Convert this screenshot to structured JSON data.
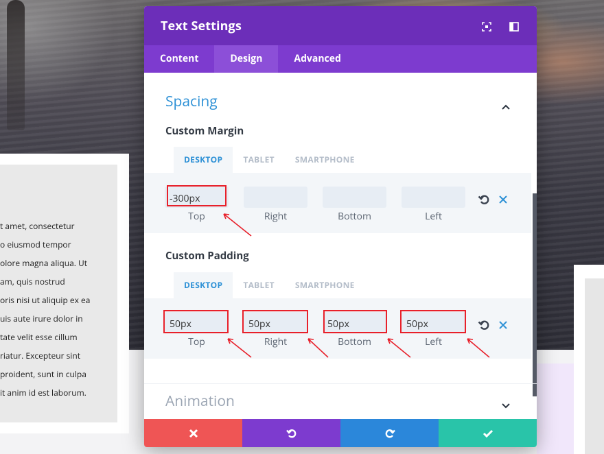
{
  "modal": {
    "title": "Text Settings",
    "tabs": [
      "Content",
      "Design",
      "Advanced"
    ],
    "active_tab": "Design"
  },
  "spacing": {
    "title": "Spacing",
    "custom_margin": {
      "label": "Custom Margin",
      "device_tabs": [
        "DESKTOP",
        "TABLET",
        "SMARTPHONE"
      ],
      "fields": [
        {
          "label": "Top",
          "value": "-300px"
        },
        {
          "label": "Right",
          "value": ""
        },
        {
          "label": "Bottom",
          "value": ""
        },
        {
          "label": "Left",
          "value": ""
        }
      ]
    },
    "custom_padding": {
      "label": "Custom Padding",
      "device_tabs": [
        "DESKTOP",
        "TABLET",
        "SMARTPHONE"
      ],
      "fields": [
        {
          "label": "Top",
          "value": "50px"
        },
        {
          "label": "Right",
          "value": "50px"
        },
        {
          "label": "Bottom",
          "value": "50px"
        },
        {
          "label": "Left",
          "value": "50px"
        }
      ]
    }
  },
  "animation": {
    "title": "Animation"
  },
  "background_text": {
    "lines": [
      "t amet, consectetur",
      "o eiusmod tempor",
      "olore magna aliqua. Ut",
      "am, quis nostrud",
      "oris nisi ut aliquip ex ea",
      "uis aute irure dolor in",
      "tate velit esse cillum",
      "riatur. Excepteur sint",
      "proident, sunt in culpa",
      "it anim id est laborum."
    ]
  },
  "colors": {
    "header": "#6c2eb9",
    "tabs_bar": "#7d3bcf",
    "accent_blue": "#2e91d6",
    "annotation_red": "#e8202a",
    "footer_cancel": "#ef5555",
    "footer_undo": "#7d3bcf",
    "footer_redo": "#2b87da",
    "footer_save": "#29c4a9"
  },
  "icons": {
    "header": [
      "expand-icon",
      "split-view-icon"
    ],
    "row_actions": [
      "reset-icon",
      "clear-icon"
    ],
    "footer": [
      "close-icon",
      "undo-icon",
      "redo-icon",
      "check-icon"
    ]
  }
}
